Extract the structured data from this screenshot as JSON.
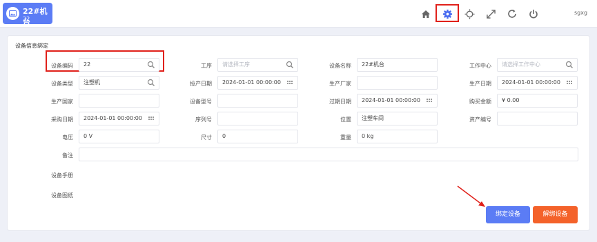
{
  "device": {
    "name": "22#机台",
    "code": "22"
  },
  "header": {
    "user": "sgxg"
  },
  "section_title": "设备信息绑定",
  "fields": {
    "device_code": {
      "label": "设备编码",
      "value": "22"
    },
    "process": {
      "label": "工序",
      "placeholder": "请选择工序"
    },
    "device_name": {
      "label": "设备名称",
      "value": "22#机台"
    },
    "work_center": {
      "label": "工作中心",
      "placeholder": "请选择工作中心"
    },
    "device_type": {
      "label": "设备类型",
      "value": "注塑机"
    },
    "launch_date": {
      "label": "投产日期",
      "value": "2024-01-01 00:00:00"
    },
    "manufacturer": {
      "label": "生产厂家",
      "value": ""
    },
    "production_date": {
      "label": "生产日期",
      "value": "2024-01-01 00:00:00"
    },
    "country": {
      "label": "生产国家",
      "value": ""
    },
    "model": {
      "label": "设备型号",
      "value": ""
    },
    "expiry_date": {
      "label": "过期日期",
      "value": "2024-01-01 00:00:00"
    },
    "purchase_amount": {
      "label": "购买金额",
      "value": "¥ 0.00"
    },
    "purchase_date": {
      "label": "采购日期",
      "value": "2024-01-01 00:00:00"
    },
    "serial_no": {
      "label": "序列号",
      "value": ""
    },
    "location": {
      "label": "位置",
      "value": "注塑车间"
    },
    "asset_no": {
      "label": "资产编号",
      "value": ""
    },
    "voltage": {
      "label": "电压",
      "value": "0 V"
    },
    "size": {
      "label": "尺寸",
      "value": "0"
    },
    "weight": {
      "label": "重量",
      "value": "0 kg"
    },
    "remark": {
      "label": "备注",
      "value": ""
    },
    "manual": {
      "label": "设备手册"
    },
    "drawing": {
      "label": "设备图纸"
    }
  },
  "buttons": {
    "bind": "绑定设备",
    "unbind": "解绑设备"
  },
  "colors": {
    "primary": "#5b7cf5",
    "danger": "#f4622a",
    "highlight": "#e0201a"
  },
  "icons": [
    "home-icon",
    "gear-icon",
    "sun-icon",
    "expand-icon",
    "refresh-icon",
    "power-icon",
    "search-icon",
    "calendar-icon",
    "image-icon"
  ]
}
